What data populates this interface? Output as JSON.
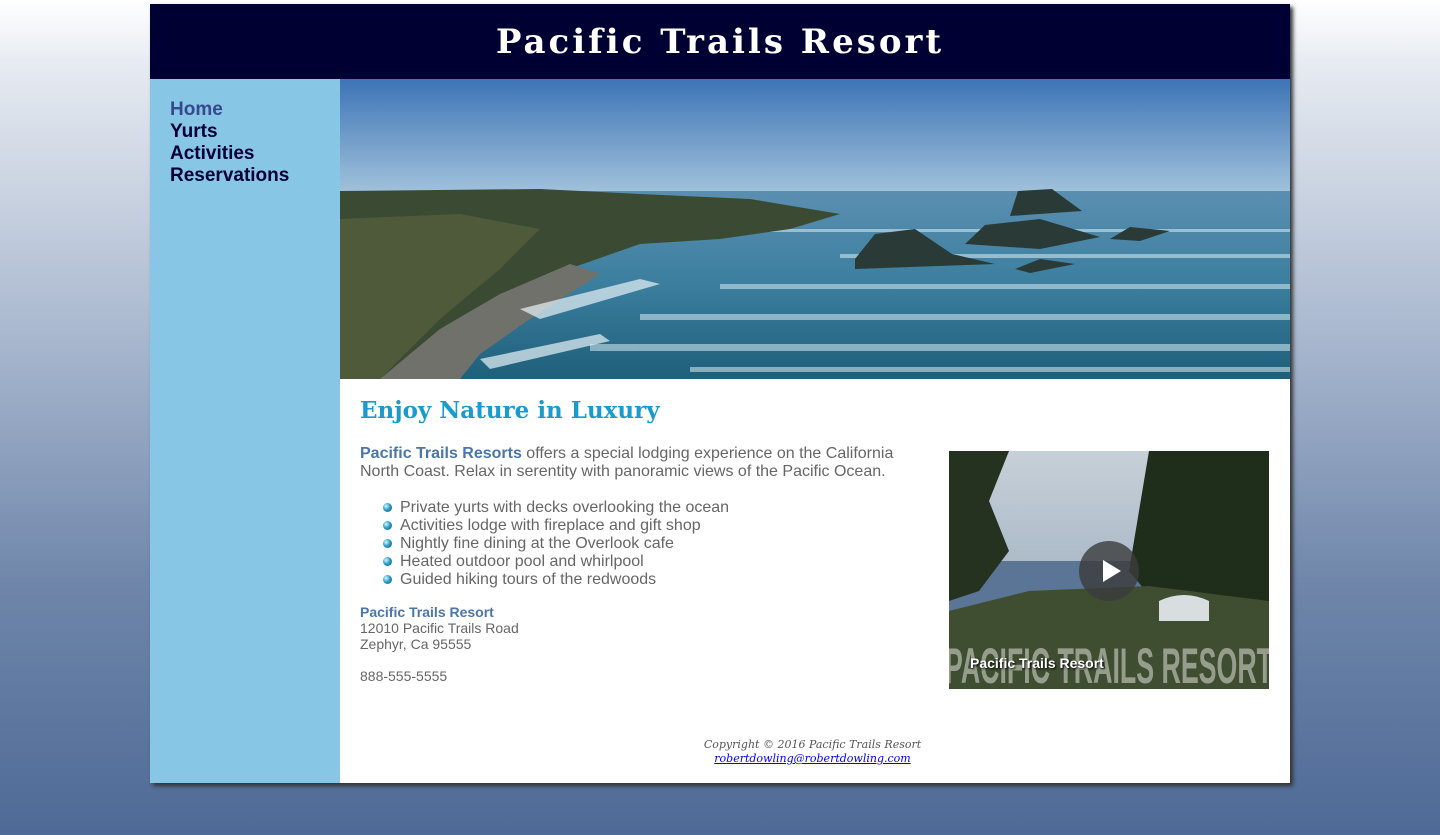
{
  "header": {
    "title": "Pacific Trails Resort"
  },
  "nav": {
    "items": [
      {
        "label": "Home"
      },
      {
        "label": "Yurts"
      },
      {
        "label": "Activities"
      },
      {
        "label": "Reservations"
      }
    ]
  },
  "main": {
    "heading": "Enjoy Nature in Luxury",
    "intro_brand": "Pacific Trails Resorts",
    "intro_text": " offers a special lodging experience on the California North Coast. Relax in serentity with panoramic views of the Pacific Ocean.",
    "features": [
      "Private yurts with decks overlooking the ocean",
      "Activities lodge with fireplace and gift shop",
      "Nightly fine dining at the Overlook cafe",
      "Heated outdoor pool and whirlpool",
      "Guided hiking tours of the redwoods"
    ],
    "contact": {
      "name": "Pacific Trails Resort",
      "street": "12010 Pacific Trails Road",
      "city": "Zephyr, Ca 95555",
      "phone": "888-555-5555"
    },
    "video": {
      "caption": "Pacific Trails Resort",
      "background_text": "PACIFIC TRAILS RESORT"
    }
  },
  "footer": {
    "copyright": "Copyright © 2016 Pacific Trails Resort",
    "email": "robertdowling@robertdowling.com"
  },
  "colors": {
    "header_bg": "#000033",
    "nav_bg": "#88c6e6",
    "heading": "#1a9bcd",
    "brand_text": "#4a76ab"
  }
}
